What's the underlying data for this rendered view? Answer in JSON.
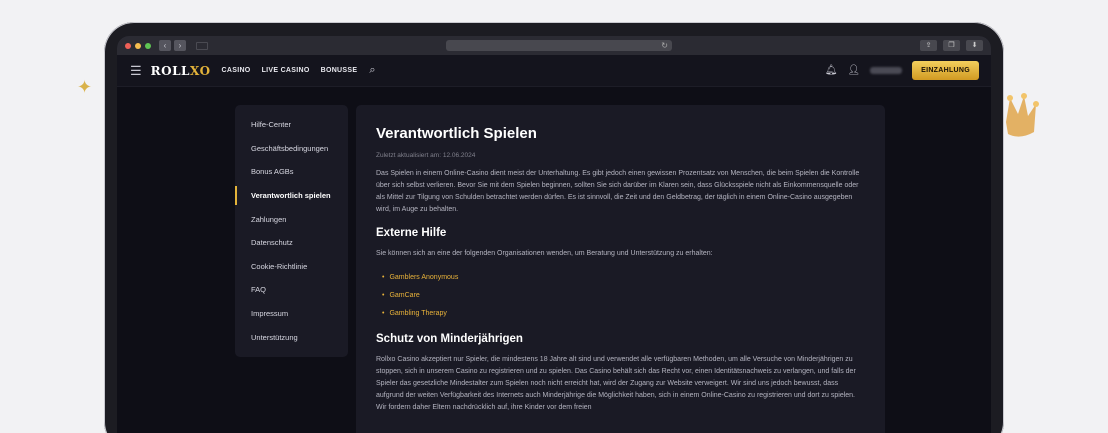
{
  "browser": {
    "nav_back": "‹",
    "nav_fwd": "›",
    "reload_icon": "↻",
    "btn_share": "⇪",
    "btn_tabs": "❐",
    "btn_download": "⬇"
  },
  "header": {
    "logo_prefix": "ROLL",
    "logo_accent": "XO",
    "nav": [
      "CASINO",
      "LIVE CASINO",
      "BONUSSE"
    ],
    "deposit_label": "EINZAHLUNG",
    "icons": [
      "hamburger-icon",
      "search-icon",
      "bell-icon",
      "user-icon"
    ]
  },
  "sidebar": {
    "items": [
      {
        "label": "Hilfe-Center"
      },
      {
        "label": "Geschäftsbedingungen"
      },
      {
        "label": "Bonus AGBs"
      },
      {
        "label": "Verantwortlich spielen"
      },
      {
        "label": "Zahlungen"
      },
      {
        "label": "Datenschutz"
      },
      {
        "label": "Cookie-Richtlinie"
      },
      {
        "label": "FAQ"
      },
      {
        "label": "Impressum"
      },
      {
        "label": "Unterstützung"
      }
    ]
  },
  "article": {
    "title": "Verantwortlich Spielen",
    "updated": "Zuletzt aktualisiert am: 12.06.2024",
    "intro": "Das Spielen in einem Online-Casino dient meist der Unterhaltung. Es gibt jedoch einen gewissen Prozentsatz von Menschen, die beim Spielen die Kontrolle über sich selbst verlieren. Bevor Sie mit dem Spielen beginnen, sollten Sie sich darüber im Klaren sein, dass Glücksspiele nicht als Einkommensquelle oder als Mittel zur Tilgung von Schulden betrachtet werden dürfen. Es ist sinnvoll, die Zeit und den Geldbetrag, der täglich in einem Online-Casino ausgegeben wird, im Auge zu behalten.",
    "h_external": "Externe Hilfe",
    "external_text": "Sie können sich an eine der folgenden Organisationen wenden, um Beratung und Unterstützung zu erhalten:",
    "links": [
      "Gamblers Anonymous",
      "GamCare",
      "Gambling Therapy"
    ],
    "h_minors": "Schutz von Minderjährigen",
    "minors_text": "Rollxo Casino akzeptiert nur Spieler, die mindestens 18 Jahre alt sind und verwendet alle verfügbaren Methoden, um alle Versuche von Minderjährigen zu stoppen, sich in unserem Casino zu registrieren und zu spielen. Das Casino behält sich das Recht vor, einen Identitätsnachweis zu verlangen, und falls der Spieler das gesetzliche Mindestalter zum Spielen noch nicht erreicht hat, wird der Zugang zur Website verweigert. Wir sind uns jedoch bewusst, dass aufgrund der weiten Verfügbarkeit des Internets auch Minderjährige die Möglichkeit haben, sich in einem Online-Casino zu registrieren und dort zu spielen. Wir fordern daher Eltern nachdrücklich auf, ihre Kinder vor dem freien"
  }
}
